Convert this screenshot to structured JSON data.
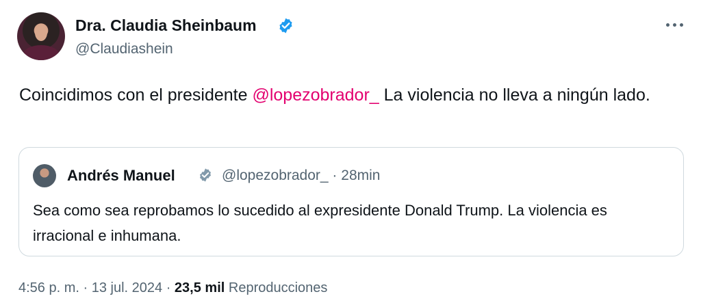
{
  "tweet": {
    "author_name": "Dra. Claudia Sheinbaum",
    "author_handle": "@Claudiashein",
    "text_before": "Coincidimos con el presidente ",
    "mention": "@lopezobrador_",
    "text_after": "   La violencia no lleva a ningún lado.",
    "verified_icon": "verified-check-icon",
    "more_icon": "more-options-icon"
  },
  "quote": {
    "author_name": "Andrés Manuel",
    "author_handle": "@lopezobrador_",
    "separator": " · ",
    "time": "28min",
    "text": "Sea como sea reprobamos lo sucedido al expresidente Donald Trump. La violencia es irracional e inhumana."
  },
  "meta": {
    "time": "4:56 p. m.",
    "dot1": " · ",
    "date": "13 jul. 2024",
    "dot2": " · ",
    "views_count": "23,5 mil",
    "views_label": "Reproducciones"
  },
  "colors": {
    "mention": "#e3006f",
    "verified": "#1d9bf0",
    "quote_verified": "#829aab"
  }
}
